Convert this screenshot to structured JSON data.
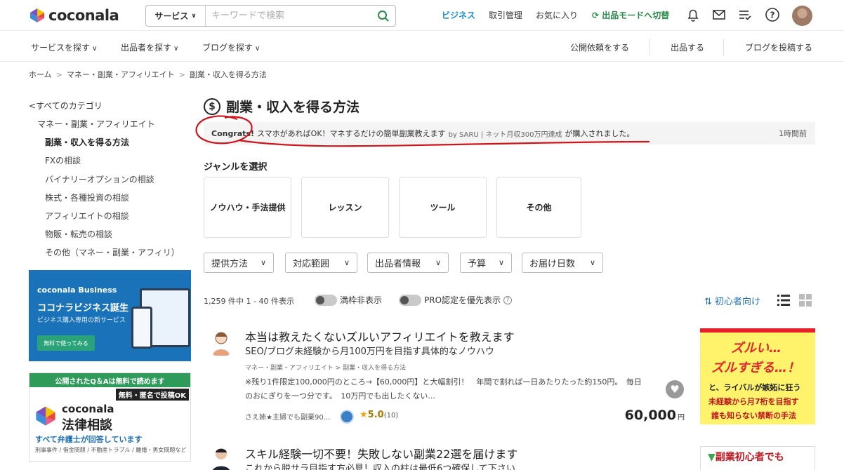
{
  "header": {
    "logo": "coconala",
    "search": {
      "category": "サービス",
      "placeholder": "キーワードで検索"
    },
    "nav": {
      "business": "ビジネス",
      "transactions": "取引管理",
      "favorites": "お気に入り",
      "mode_switch": "出品モードへ切替"
    }
  },
  "subnav": {
    "find_services": "サービスを探す",
    "find_sellers": "出品者を探す",
    "find_blogs": "ブログを探す",
    "post_request": "公開依頼をする",
    "sell": "出品する",
    "post_blog": "ブログを投稿する"
  },
  "breadcrumb": [
    "ホーム",
    "マネー・副業・アフィリエイト",
    "副業・収入を得る方法"
  ],
  "sidebar": {
    "all_categories": "すべてのカテゴリ",
    "parent": "マネー・副業・アフィリエイト",
    "items": [
      "副業・収入を得る方法",
      "FXの相談",
      "バイナリーオプションの相談",
      "株式・各種投資の相談",
      "アフィリエイトの相談",
      "物販・転売の相談",
      "その他（マネー・副業・アフィリ）"
    ],
    "active_index": 0
  },
  "banner_business": {
    "logo": "coconala Business",
    "title": "ココナラビジネス誕生",
    "subtitle": "ビジネス購入専用の新サービス",
    "button": "無料で使ってみる"
  },
  "banner_legal": {
    "top": "公開されたQ＆Aは無料で読めます",
    "tag": "無料・匿名で投稿OK",
    "brand": "coconala",
    "title": "法律相談",
    "subtitle": "すべて弁護士が回答しています",
    "footer": "刑事事件 / 借金問題 / 不動産トラブル / 離婚・男女問題など"
  },
  "page_title": "副業・収入を得る方法",
  "congrats": {
    "label": "Congrats!",
    "service": "スマホがあればOK！マネするだけの簡単副業教えます",
    "by": "by SARU | ネット月収300万円達成",
    "suffix": "が購入されました。",
    "time": "1時間前"
  },
  "genre": {
    "heading": "ジャンルを選択",
    "options": [
      "ノウハウ・手法提供",
      "レッスン",
      "ツール",
      "その他"
    ]
  },
  "filters": [
    "提供方法",
    "対応範囲",
    "出品者情報",
    "予算",
    "お届け日数"
  ],
  "results": {
    "count": "1,259 件中 1 - 40 件表示",
    "toggle_hide_full": "満枠非表示",
    "toggle_pro": "PRO認定を優先表示",
    "sort": "初心者向け"
  },
  "listings": [
    {
      "title": "本当は教えたくないズルいアフィリエイトを教えます",
      "subtitle": "SEO/ブログ未経験から月100万円を目指す具体的なノウハウ",
      "category": "マネー・副業・アフィリエイト > 副業・収入を得る方法",
      "description": "※残り1件限定100,000円のところ→【60,000円】と大幅割引！　年間で割れば一日あたりたった約150円。　毎日のおにぎりを一つ分です。　10万円でも出したくない...",
      "seller": "さえ姉★主婦でも副業90...",
      "rating": "5.0",
      "reviews": "(10)",
      "price": "60,000",
      "yen": "円",
      "thumb": {
        "line1": "ズルい…",
        "line2": "ズルすぎる…！",
        "line3": "と、ライバルが嫉妬に狂う",
        "line4": "未経験から月7桁を目指す",
        "line5": "誰も知らない禁断の手法"
      }
    },
    {
      "title": "スキル経験一切不要！失敗しない副業22選を届けます",
      "subtitle": "これから脱サラ目指す方必見！収入の柱は最低6つ確保して下さい",
      "thumb": {
        "line1": "副業初心者でも"
      }
    }
  ],
  "colors": {
    "accent_blue": "#1e8fd1",
    "mode_green": "#2a8a4b",
    "annotation_red": "#d0141b",
    "star": "#f0a800"
  }
}
